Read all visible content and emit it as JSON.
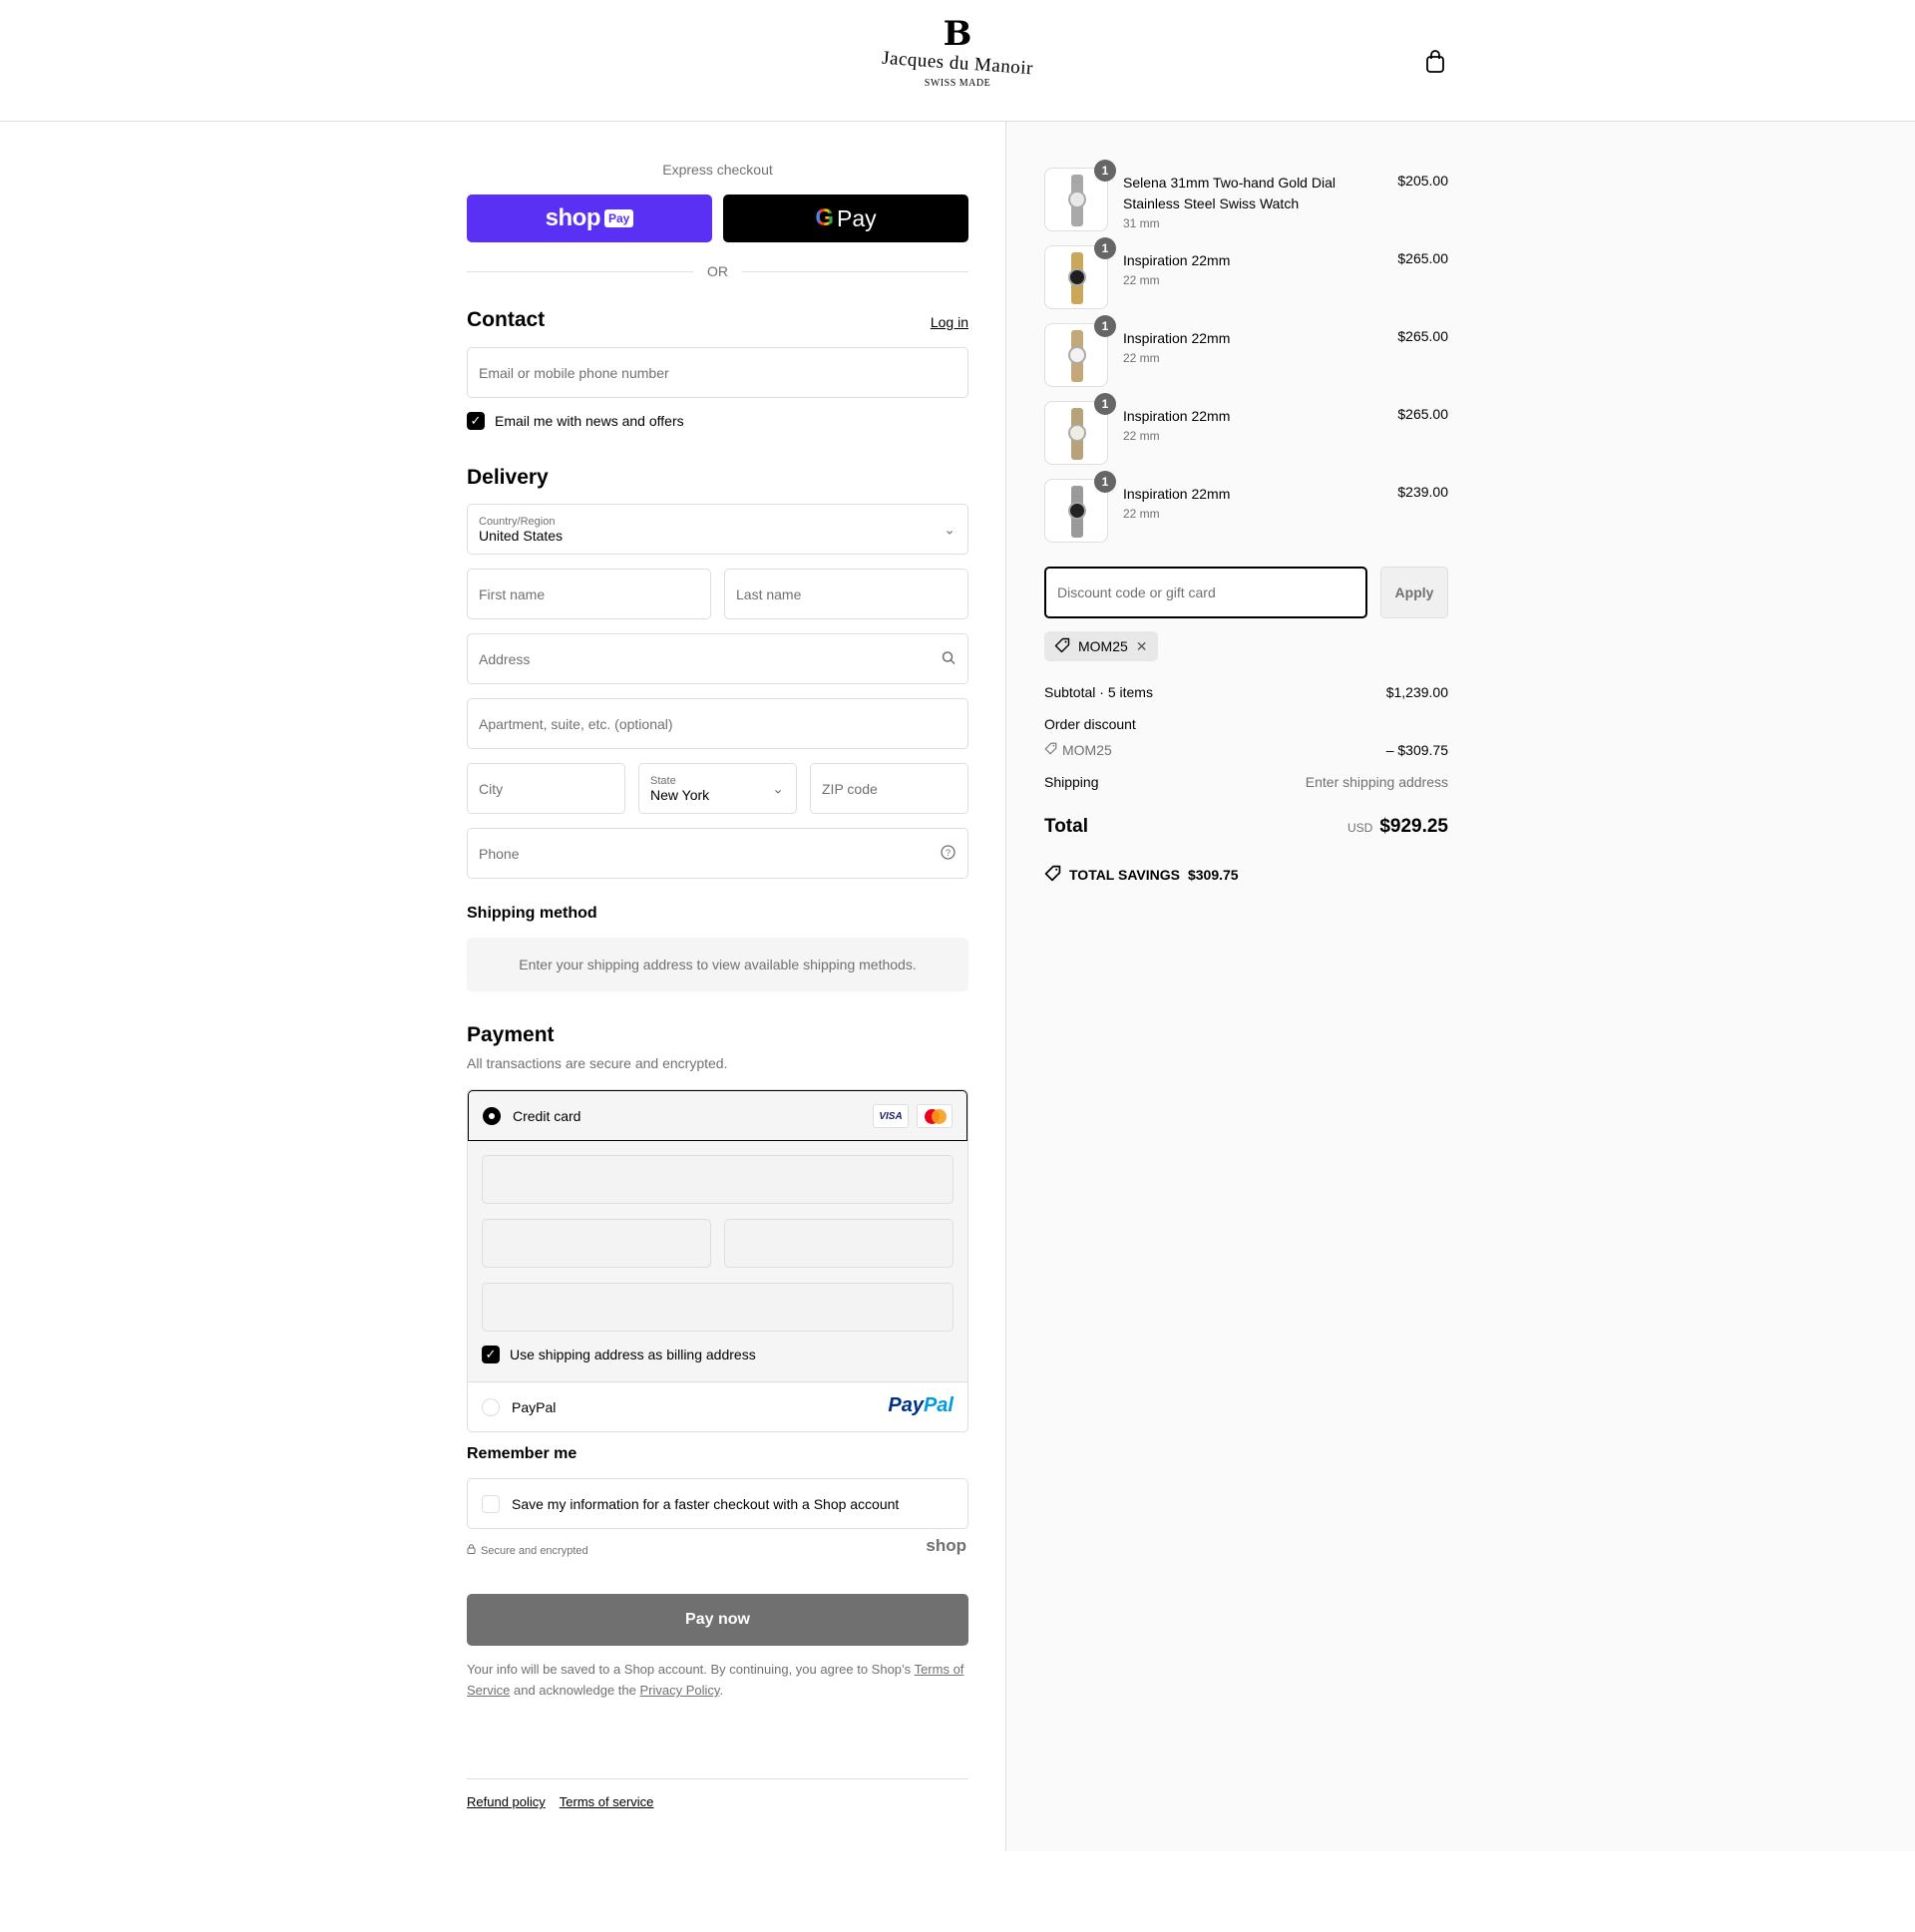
{
  "header": {
    "brand_monogram": "B",
    "brand_name": "Jacques du Manoir",
    "brand_tagline": "SWISS MADE",
    "cart_icon": "shopping-bag-icon"
  },
  "express": {
    "label": "Express checkout",
    "shop_pay_word": "shop",
    "shop_pay_badge": "Pay",
    "gpay_g": "G",
    "gpay_word": "Pay",
    "or_label": "OR"
  },
  "contact": {
    "title": "Contact",
    "login_label": "Log in",
    "email_placeholder": "Email or mobile phone number",
    "newsletter_label": "Email me with news and offers",
    "newsletter_checked": true
  },
  "delivery": {
    "title": "Delivery",
    "country_label": "Country/Region",
    "country_value": "United States",
    "first_name_placeholder": "First name",
    "last_name_placeholder": "Last name",
    "address_placeholder": "Address",
    "apartment_placeholder": "Apartment, suite, etc. (optional)",
    "city_placeholder": "City",
    "state_label": "State",
    "state_value": "New York",
    "zip_placeholder": "ZIP code",
    "phone_placeholder": "Phone"
  },
  "shipping_method": {
    "title": "Shipping method",
    "message": "Enter your shipping address to view available shipping methods."
  },
  "payment": {
    "title": "Payment",
    "subtitle": "All transactions are secure and encrypted.",
    "credit_card_label": "Credit card",
    "visa_label": "VISA",
    "billing_same_label": "Use shipping address as billing address",
    "paypal_label": "PayPal",
    "paypal_logo_a": "Pay",
    "paypal_logo_b": "Pal"
  },
  "remember": {
    "title": "Remember me",
    "save_label": "Save my information for a faster checkout with a Shop account",
    "secure_label": "Secure and encrypted",
    "shop_logo": "shop"
  },
  "pay_now_label": "Pay now",
  "legal": {
    "text_1": "Your info will be saved to a Shop account. By continuing, you agree to Shop’s",
    "terms_link": "Terms of Service",
    "text_2": "and acknowledge the",
    "privacy_link": "Privacy Policy",
    "text_3": "."
  },
  "footer": {
    "refund_link": "Refund policy",
    "terms_link": "Terms of service"
  },
  "summary": {
    "items": [
      {
        "qty": "1",
        "name": "Selena 31mm Two-hand Gold Dial Stainless Steel Swiss Watch",
        "variant": "31 mm",
        "price": "$205.00",
        "dial_color": "#e8e8e8",
        "band_color": "#a8a8a8"
      },
      {
        "qty": "1",
        "name": "Inspiration 22mm",
        "variant": "22 mm",
        "price": "$265.00",
        "dial_color": "#1e1e1e",
        "band_color": "#c9a85a"
      },
      {
        "qty": "1",
        "name": "Inspiration 22mm",
        "variant": "22 mm",
        "price": "$265.00",
        "dial_color": "#f2f2f2",
        "band_color": "#c4a87a"
      },
      {
        "qty": "1",
        "name": "Inspiration 22mm",
        "variant": "22 mm",
        "price": "$265.00",
        "dial_color": "#f0ede4",
        "band_color": "#b8a27a"
      },
      {
        "qty": "1",
        "name": "Inspiration 22mm",
        "variant": "22 mm",
        "price": "$239.00",
        "dial_color": "#222222",
        "band_color": "#9a9a9a"
      }
    ],
    "discount_placeholder": "Discount code or gift card",
    "apply_label": "Apply",
    "applied_code": "MOM25",
    "subtotal_label": "Subtotal · 5 items",
    "subtotal_value": "$1,239.00",
    "order_discount_label": "Order discount",
    "discount_code": "MOM25",
    "discount_value": "– $309.75",
    "shipping_label": "Shipping",
    "shipping_value": "Enter shipping address",
    "total_label": "Total",
    "total_currency": "USD",
    "total_value": "$929.25",
    "savings_label": "TOTAL SAVINGS",
    "savings_value": "$309.75"
  },
  "colors": {
    "shop_pay": "#5a31f4",
    "pay_now": "#707070",
    "border": "#dedede",
    "summary_bg": "#fafafa"
  }
}
